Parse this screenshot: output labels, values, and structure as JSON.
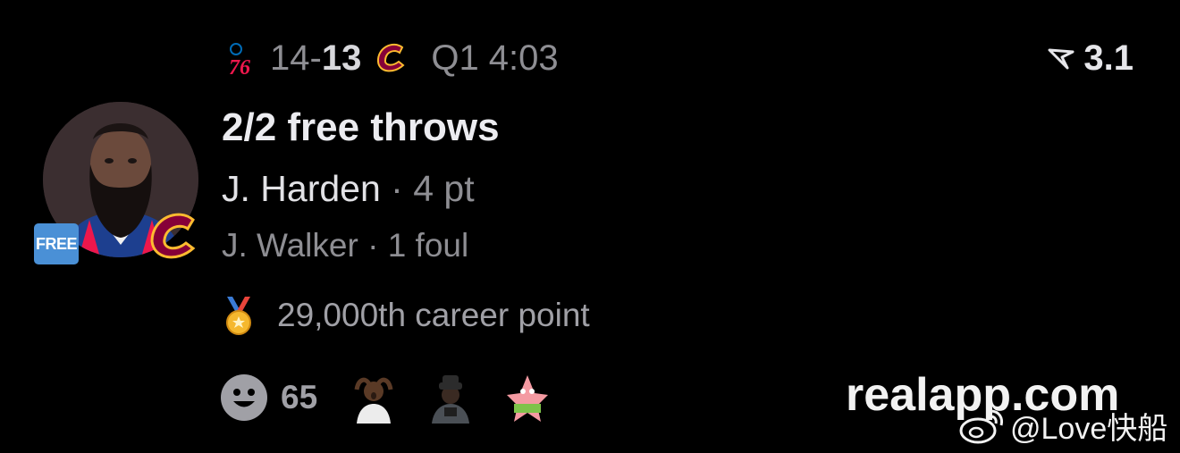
{
  "scoreboard": {
    "away_logo_text": "76",
    "away_score": "14",
    "dash": "-",
    "home_score": "13",
    "clock": "Q1 4:03"
  },
  "rating": {
    "value": "3.1",
    "icon": "signal-pointer-icon"
  },
  "play": {
    "headline": "2/2 free throws",
    "player1": {
      "name": "J. Harden",
      "sep": " · ",
      "stat": "4 pt"
    },
    "player2": {
      "name": "J. Walker",
      "sep": " · ",
      "stat": "1 foul"
    }
  },
  "badge": {
    "label": "FREE",
    "color": "#4a90d6"
  },
  "milestone": {
    "icon": "medal-icon",
    "text": "29,000th career point"
  },
  "reactions": {
    "count": "65",
    "button_icon": "smiley-icon",
    "stickers": [
      "sticker-man-hands-on-head",
      "sticker-man-in-hat",
      "sticker-patrick-star"
    ]
  },
  "watermark": {
    "site": "realapp.com",
    "weibo": "@Love快船"
  },
  "colors": {
    "background": "#000000",
    "secondary_text": "#8e8e93",
    "cavs_wine": "#860038",
    "cavs_gold": "#fdbb30",
    "sixers_red": "#ed174c",
    "sixers_blue": "#006bb6"
  }
}
